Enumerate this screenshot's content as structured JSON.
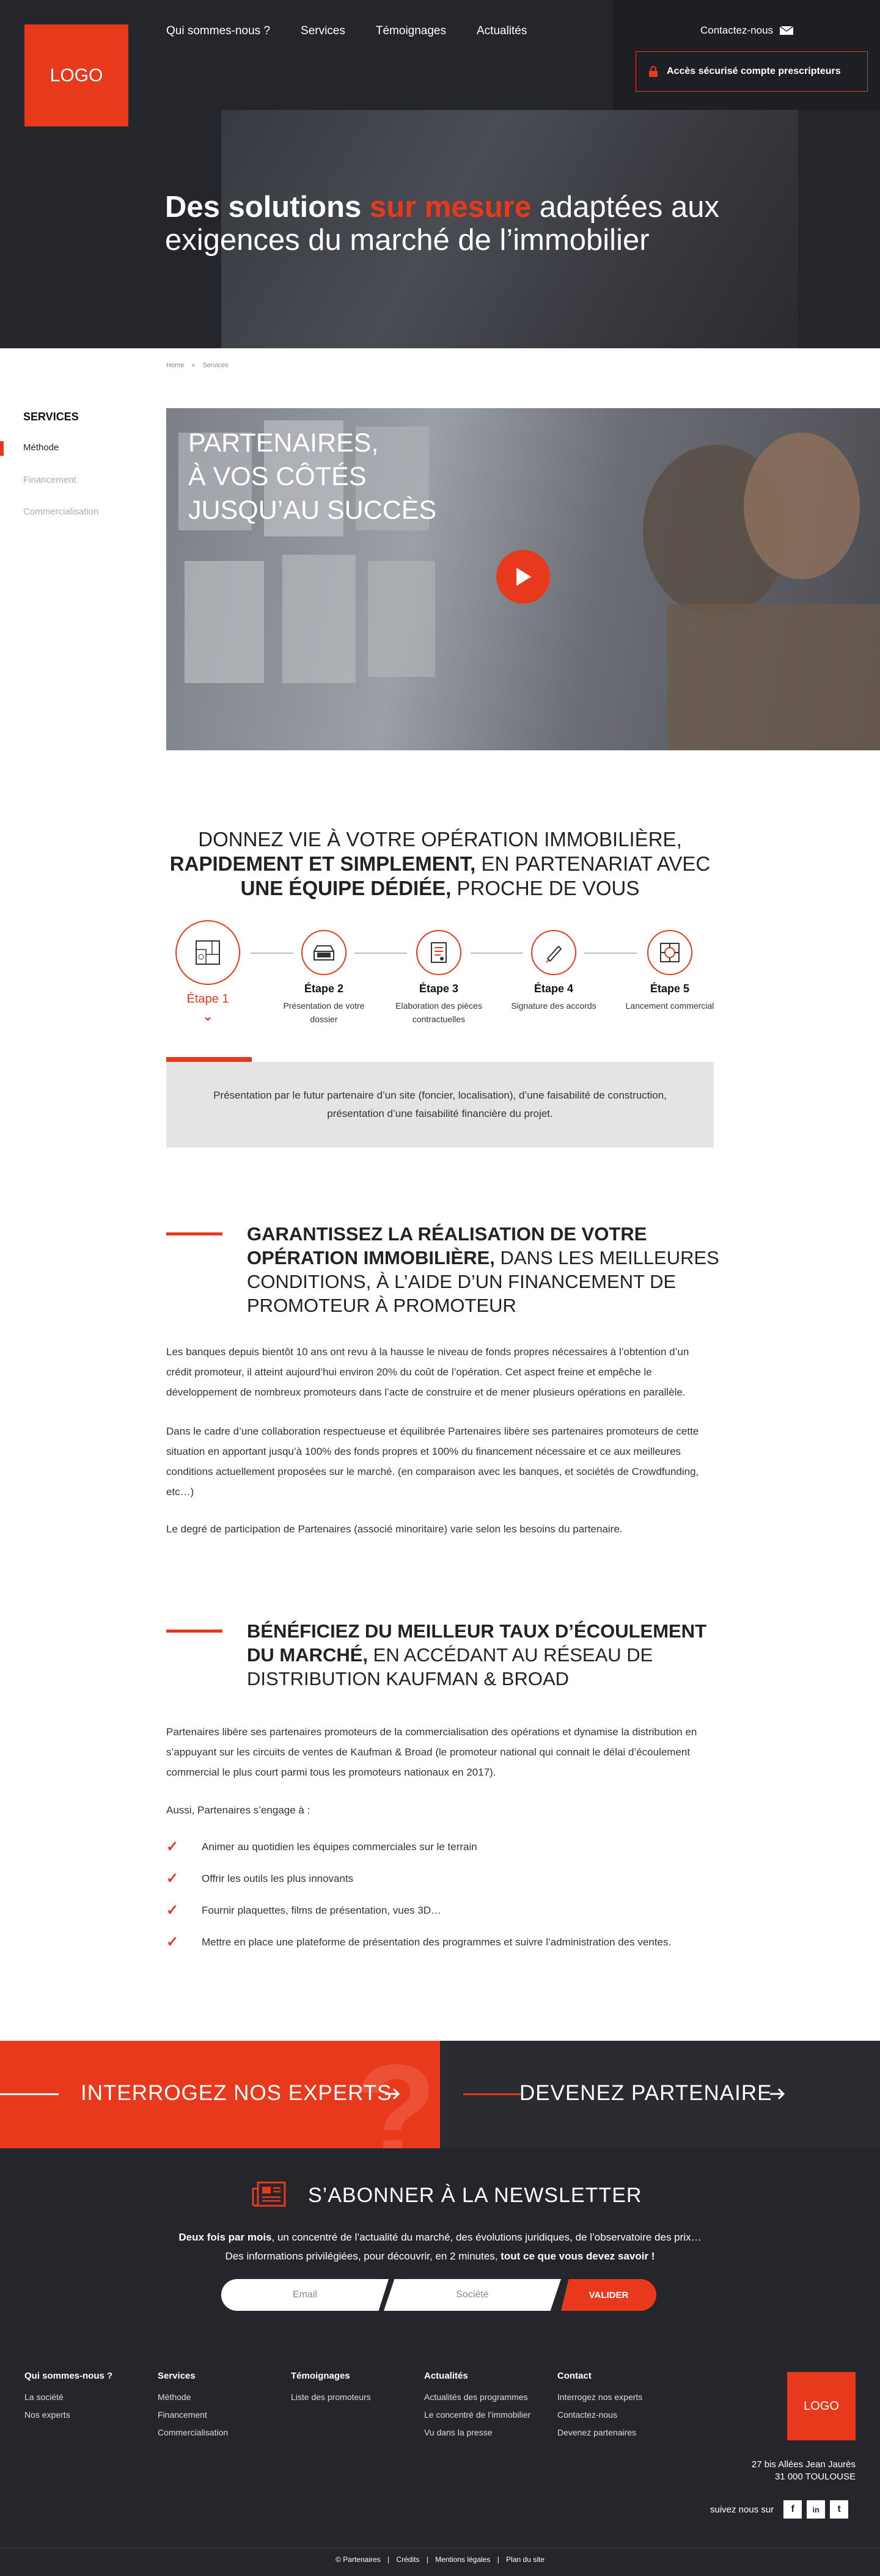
{
  "header": {
    "logo": "LOGO",
    "nav": [
      "Qui sommes-nous ?",
      "Services",
      "Témoignages",
      "Actualités"
    ],
    "contact_label": "Contactez-nous",
    "access_label": "Accès sécurisé compte prescripteurs",
    "hero_part1": "Des solutions ",
    "hero_accent": "sur mesure",
    "hero_part2": " adaptées aux exigences du marché de l’immobilier"
  },
  "breadcrumb": [
    "Home",
    "»",
    "Services"
  ],
  "sidebar": {
    "title": "SERVICES",
    "items": [
      "Méthode",
      "Financement",
      "Commercialisation"
    ]
  },
  "video": {
    "overlay_lines": [
      "PARTENAIRES,",
      "À VOS CÔTÉS",
      "JUSQU’AU SUCCÈS"
    ]
  },
  "steps_heading": {
    "l1": "DONNEZ VIE À VOTRE OPÉRATION IMMOBILIÈRE,",
    "l2_bold": "RAPIDEMENT ET SIMPLEMENT,",
    "l2_rest": " EN PARTENARIAT AVEC",
    "l3_bold": "UNE ÉQUIPE DÉDIÉE,",
    "l3_rest": " PROCHE DE VOUS"
  },
  "steps": [
    {
      "title": "Étape 1",
      "desc": ""
    },
    {
      "title": "Étape 2",
      "desc": "Présentation de votre dossier"
    },
    {
      "title": "Étape 3",
      "desc": "Elaboration des pièces contractuelles"
    },
    {
      "title": "Étape 4",
      "desc": "Signature des accords"
    },
    {
      "title": "Étape 5",
      "desc": "Lancement commercial"
    }
  ],
  "step_detail": "Présentation par le futur partenaire d’un site (foncier, localisation), d’une faisabilité de construction, présentation d’une faisabilité financière du projet.",
  "section1": {
    "bold": "GARANTISSEZ LA RÉALISATION DE VOTRE OPÉRATION IMMOBILIÈRE,",
    "rest": " DANS LES MEILLEURES CONDITIONS, À L’AIDE D’UN FINANCEMENT DE PROMOTEUR À PROMOTEUR",
    "p1": "Les banques depuis bientôt 10 ans ont revu à la hausse le niveau de fonds propres nécessaires à l’obtention d’un crédit promoteur, il atteint aujourd’hui environ 20% du coût de l’opération. Cet aspect freine et empêche le développement de nombreux promoteurs dans l’acte de construire et de mener plusieurs opérations en parallèle.",
    "p2": "Dans le cadre d’une collaboration respectueuse et équilibrée Partenaires libère ses partenaires promoteurs de cette situation en apportant jusqu’à 100% des fonds propres et 100% du financement nécessaire et ce aux meilleures conditions actuellement proposées sur le marché. (en comparaison avec les banques, et sociétés de Crowdfunding, etc…)",
    "p3": "Le degré de participation de Partenaires (associé minoritaire) varie selon les besoins du partenaire."
  },
  "section2": {
    "bold": "BÉNÉFICIEZ DU MEILLEUR TAUX D’ÉCOULEMENT DU MARCHÉ,",
    "rest": " EN ACCÉDANT AU RÉSEAU DE DISTRIBUTION KAUFMAN & BROAD",
    "p1": "Partenaires libère ses partenaires promoteurs de la commercialisation des opérations et dynamise la distribution en s’appuyant sur les circuits de ventes de Kaufman & Broad (le promoteur national qui connait le délai d’écoulement commercial le plus court parmi tous les promoteurs nationaux en 2017).",
    "p2": "Aussi, Partenaires s’engage à :",
    "bullets": [
      "Animer au quotidien les équipes commerciales sur le terrain",
      "Offrir les outils les plus innovants",
      "Fournir plaquettes, films de présentation, vues 3D…",
      "Mettre en place une plateforme de présentation des programmes et suivre l’administration des ventes."
    ]
  },
  "cta": {
    "left": "INTERROGEZ NOS EXPERTS",
    "right": "DEVENEZ PARTENAIRE"
  },
  "newsletter": {
    "title": "S’ABONNER À LA NEWSLETTER",
    "t1_bold": "Deux fois par mois",
    "t1_rest": ", un concentré de l’actualité du marché, des évolutions juridiques, de l’observatoire des prix…",
    "t2_rest": "Des informations privilégiées, pour découvrir, en 2 minutes, ",
    "t2_bold": "tout ce que vous devez savoir !",
    "email_placeholder": "Email",
    "company_placeholder": "Société",
    "submit": "VALIDER"
  },
  "footer": {
    "columns": [
      {
        "head": "Qui sommes-nous ?",
        "links": [
          "La société",
          "Nos experts"
        ]
      },
      {
        "head": "Services",
        "links": [
          "Méthode",
          "Financement",
          "Commercialisation"
        ]
      },
      {
        "head": "Témoignages",
        "links": [
          "Liste des promoteurs"
        ]
      },
      {
        "head": "Actualités",
        "links": [
          "Actualités des programmes",
          "Le concentré de l’immobilier",
          "Vu dans la presse"
        ]
      },
      {
        "head": "Contact",
        "links": [
          "Interrogez nos experts",
          "Contactez-nous",
          "Devenez partenaires"
        ]
      }
    ],
    "logo": "LOGO",
    "address_l1": "27 bis Allées Jean Jaurès",
    "address_l2": "31 000 TOULOUSE",
    "follow": "suivez nous sur",
    "legal": [
      "© Partenaires",
      "Crédits",
      "Mentions légales",
      "Plan du site"
    ],
    "legal_sep": "|"
  },
  "colors": {
    "accent": "#e8391d",
    "dark": "#24262c"
  }
}
